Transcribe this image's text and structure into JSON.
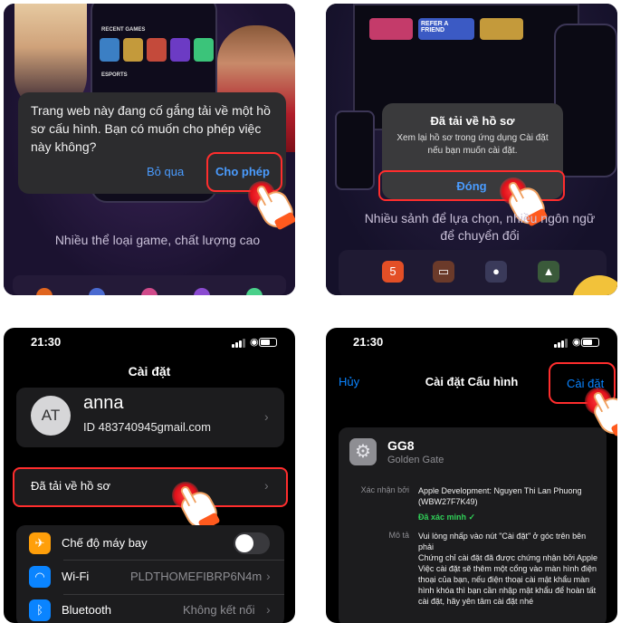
{
  "panel1": {
    "phone_labels": [
      "RECENT GAMES",
      "ESPORTS"
    ],
    "dialog_message": "Trang web này đang cố gắng tải về một hồ sơ cấu hình. Bạn có muốn cho phép việc này không?",
    "skip_label": "Bỏ qua",
    "allow_label": "Cho phép",
    "caption": "Nhiều thể loại game, chất lượng cao"
  },
  "panel2": {
    "banner_text": "REFER A FRIEND",
    "dialog_title": "Đã tải về hồ sơ",
    "dialog_body": "Xem lại hồ sơ trong ứng dụng Cài đặt nếu bạn muốn cài đặt.",
    "close_label": "Đóng",
    "caption": "Nhiều sảnh để lựa chọn, nhiều ngôn ngữ để chuyển đổi"
  },
  "panel3": {
    "time": "21:30",
    "title": "Cài đặt",
    "avatar_initials": "AT",
    "account_name": "anna",
    "account_id": "ID 483740945gmail.com",
    "profile_downloaded": "Đã tải về hồ sơ",
    "rows": [
      {
        "label": "Chế độ máy bay",
        "value": "",
        "icon": "airplane-icon",
        "color": "#ff9f0a"
      },
      {
        "label": "Wi-Fi",
        "value": "PLDTHOMEFIBRP6N4m",
        "icon": "wifi-icon",
        "color": "#0a84ff"
      },
      {
        "label": "Bluetooth",
        "value": "Không kết nối",
        "icon": "bluetooth-icon",
        "color": "#0a84ff"
      }
    ]
  },
  "panel4": {
    "time": "21:30",
    "cancel": "Hủy",
    "title": "Cài đặt Cấu hình",
    "install": "Cài đặt",
    "profile_name": "GG8",
    "profile_sub": "Golden Gate",
    "verified_by_label": "Xác nhận bởi",
    "verified_by_value": "Apple Development: Nguyen Thi Lan Phuong (WBW27F7K49)",
    "verified_status": "Đã xác minh ✓",
    "description_label": "Mô tả",
    "description_value": "Vui lòng nhấp vào nút \"Cài đặt\" ở góc trên bên phải\nChứng chỉ cài đặt đã được chứng nhận bởi Apple Việc cài đặt sẽ thêm một cổng vào màn hình điện thoại của bạn, nếu điện thoại cài mật khẩu màn hình khóa thì bạn cần nhập mật khẩu để hoàn tất cài đặt, hãy yên tâm cài đặt nhé"
  },
  "colors": {
    "highlight": "#ff2d2d",
    "ios_link": "#0a84ff",
    "verified": "#30d158"
  }
}
